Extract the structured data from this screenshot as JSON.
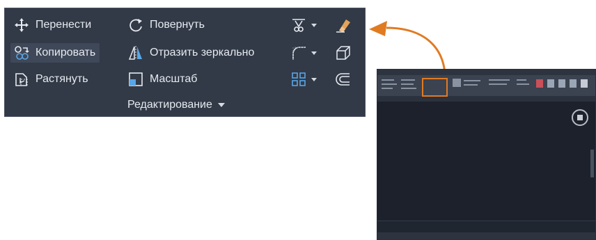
{
  "panel": {
    "title": "Редактирование",
    "commands": [
      {
        "label": "Перенести",
        "icon": "move-icon"
      },
      {
        "label": "Повернуть",
        "icon": "rotate-icon"
      },
      {
        "label": "Копировать",
        "icon": "copy-icon",
        "active": true
      },
      {
        "label": "Отразить зеркально",
        "icon": "mirror-icon"
      },
      {
        "label": "Растянуть",
        "icon": "stretch-icon"
      },
      {
        "label": "Масштаб",
        "icon": "scale-icon"
      }
    ],
    "tools": [
      {
        "icon": "trim-icon",
        "has_dropdown": true
      },
      {
        "icon": "erase-icon",
        "has_dropdown": false
      },
      {
        "icon": "fillet-icon",
        "has_dropdown": true
      },
      {
        "icon": "explode-icon",
        "has_dropdown": false
      },
      {
        "icon": "array-icon",
        "has_dropdown": true
      },
      {
        "icon": "offset-icon",
        "has_dropdown": false
      }
    ]
  },
  "colors": {
    "panel_bg": "#323a47",
    "text": "#e6eaf0",
    "accent_orange": "#e07b22",
    "icon_blue": "#5aa5e6"
  }
}
